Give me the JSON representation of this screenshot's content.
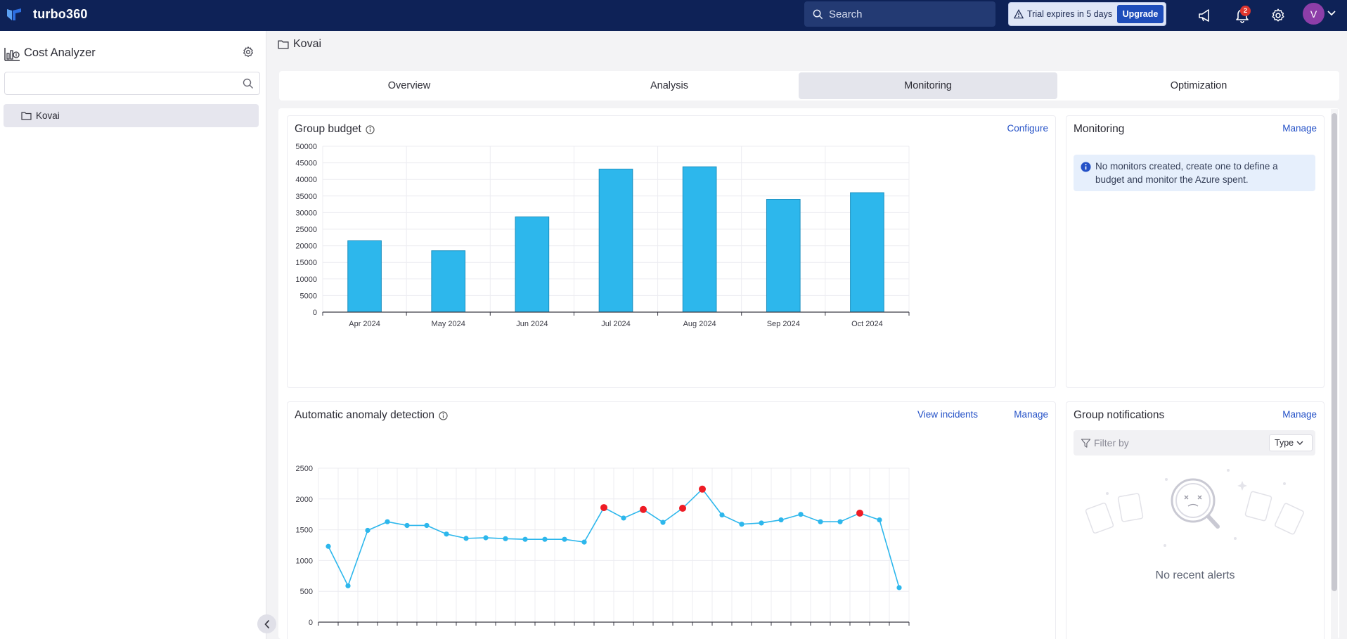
{
  "header": {
    "brand": "turbo360",
    "search_placeholder": "Search",
    "trial_text": "Trial expires in 5 days",
    "upgrade_label": "Upgrade",
    "notification_count": "2",
    "avatar_initial": "V"
  },
  "sidebar": {
    "title": "Cost Analyzer",
    "search_value": "",
    "items": [
      {
        "label": "Kovai"
      }
    ]
  },
  "breadcrumb": {
    "label": "Kovai"
  },
  "tabs": [
    {
      "label": "Overview"
    },
    {
      "label": "Analysis"
    },
    {
      "label": "Monitoring",
      "active": true
    },
    {
      "label": "Optimization"
    }
  ],
  "budget_card": {
    "title": "Group budget",
    "configure_label": "Configure"
  },
  "monitoring_card": {
    "title": "Monitoring",
    "manage_label": "Manage",
    "notice": "No monitors created, create one to define a budget and monitor the Azure spent."
  },
  "anomaly_card": {
    "title": "Automatic anomaly detection",
    "view_incidents_label": "View incidents",
    "manage_label": "Manage"
  },
  "notifications_card": {
    "title": "Group notifications",
    "manage_label": "Manage",
    "filter_placeholder": "Filter by",
    "type_label": "Type",
    "empty_text": "No recent alerts"
  },
  "colors": {
    "bar": "#2db7ec",
    "anomaly": "#ee1c25",
    "topbar": "#0e2257",
    "link": "#2451c7"
  },
  "chart_data": [
    {
      "type": "bar",
      "categories": [
        "Apr 2024",
        "May 2024",
        "Jun 2024",
        "Jul 2024",
        "Aug 2024",
        "Sep 2024",
        "Oct 2024"
      ],
      "values": [
        21500,
        18500,
        28700,
        43100,
        43800,
        34000,
        36000
      ],
      "yticks": [
        0,
        5000,
        10000,
        15000,
        20000,
        25000,
        30000,
        35000,
        40000,
        45000,
        50000
      ],
      "ylim": [
        0,
        50000
      ],
      "grid": true
    },
    {
      "type": "line",
      "values": [
        1230,
        590,
        1490,
        1630,
        1570,
        1570,
        1430,
        1360,
        1370,
        1355,
        1345,
        1345,
        1345,
        1300,
        1860,
        1690,
        1830,
        1620,
        1850,
        2160,
        1740,
        1590,
        1610,
        1660,
        1750,
        1630,
        1630,
        1770,
        1660,
        560
      ],
      "anomalies": [
        14,
        16,
        18,
        19,
        27
      ],
      "yticks": [
        0,
        500,
        1000,
        1500,
        2000,
        2500
      ],
      "ylim": [
        0,
        2500
      ],
      "grid": true
    }
  ]
}
